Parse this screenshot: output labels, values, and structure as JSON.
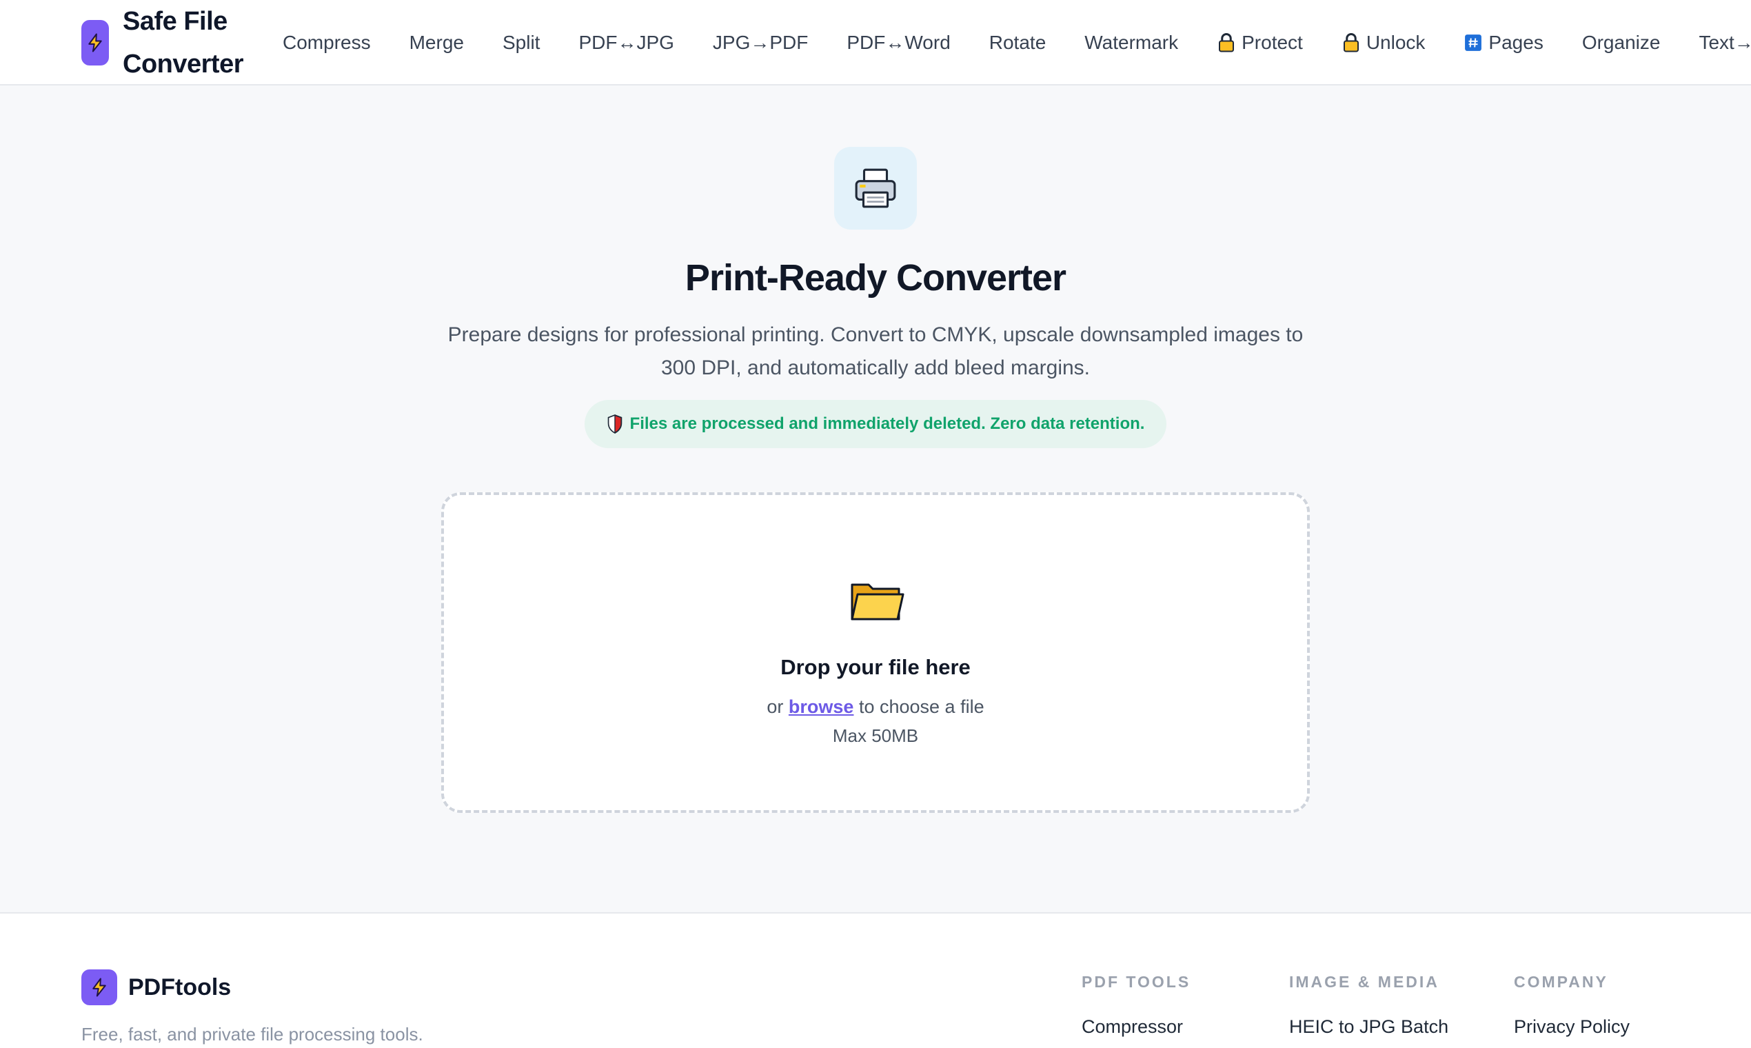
{
  "brand": {
    "name": "Safe File Converter",
    "icon": "lightning-bolt-icon"
  },
  "nav": {
    "items": [
      {
        "label": "Compress"
      },
      {
        "label": "Merge"
      },
      {
        "label": "Split"
      },
      {
        "label": "PDF↔JPG"
      },
      {
        "label": "JPG→PDF"
      },
      {
        "label": "PDF↔Word"
      },
      {
        "label": "Rotate"
      },
      {
        "label": "Watermark"
      },
      {
        "label": "Protect",
        "icon": "lock-icon"
      },
      {
        "label": "Unlock",
        "icon": "lock-icon"
      },
      {
        "label": "Pages",
        "icon": "hash-icon"
      },
      {
        "label": "Organize"
      },
      {
        "label": "Text→PDF"
      }
    ]
  },
  "hero": {
    "icon": "printer-icon",
    "title": "Print-Ready Converter",
    "subtitle": "Prepare designs for professional printing. Convert to CMYK, upscale downsampled images to 300 DPI, and automatically add bleed margins.",
    "privacy_badge": "Files are processed and immediately deleted. Zero data retention.",
    "privacy_icon": "shield-icon"
  },
  "dropzone": {
    "icon": "folder-icon",
    "title": "Drop your file here",
    "prefix": "or",
    "browse": "browse",
    "suffix": "to choose a file",
    "max": "Max 50MB"
  },
  "footer": {
    "brand": "PDFtools",
    "tagline": "Free, fast, and private file processing tools.",
    "columns": [
      {
        "title": "PDF TOOLS",
        "links": [
          "Compressor"
        ]
      },
      {
        "title": "IMAGE & MEDIA",
        "links": [
          "HEIC to JPG Batch"
        ]
      },
      {
        "title": "COMPANY",
        "links": [
          "Privacy Policy"
        ]
      }
    ]
  },
  "colors": {
    "accent": "#7c5cf4",
    "link": "#6d5ae6",
    "success": "#10a36b",
    "success_bg": "#e6f4ef",
    "hero_icon_bg": "#e3f2fa"
  }
}
